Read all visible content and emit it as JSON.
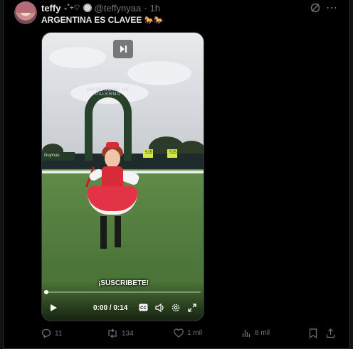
{
  "post": {
    "display_name": "teffy",
    "name_decoration": "₊˚÷♡",
    "handle": "@teffynyaa",
    "separator": "·",
    "timestamp": "1h",
    "text": "ARGENTINA ES CLAVEE",
    "text_emoji": "🐎🐎"
  },
  "video": {
    "subtitle": "¡SUSCRIBETE!",
    "time_display": "0:00 / 0:14",
    "progress": 0.0,
    "scene_texts": {
      "arch": "HIPODROMO DE PALERMO",
      "ad1": "Nuyinas",
      "ad2": "515",
      "ad3": "515"
    }
  },
  "actions": {
    "replies": "11",
    "reposts": "134",
    "likes": "1 mil",
    "views": "8 mil"
  },
  "colors": {
    "background": "#000000",
    "text_primary": "#e7e9ea",
    "text_secondary": "#71767b",
    "accent": "#1d9bf0"
  },
  "icons": [
    "grok-icon",
    "more-icon",
    "pause-icon",
    "play-icon",
    "captions-icon",
    "volume-icon",
    "settings-icon",
    "fullscreen-icon",
    "reply-icon",
    "repost-icon",
    "like-icon",
    "views-icon",
    "bookmark-icon",
    "share-icon"
  ]
}
